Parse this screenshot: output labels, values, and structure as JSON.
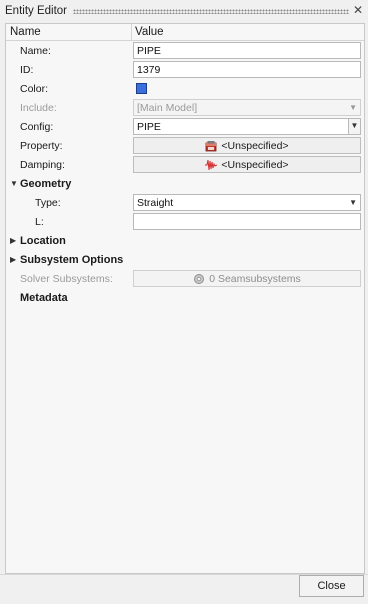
{
  "window": {
    "title": "Entity Editor",
    "close_glyph": "✕"
  },
  "table": {
    "col_name": "Name",
    "col_value": "Value"
  },
  "fields": {
    "name": {
      "label": "Name:",
      "value": "PIPE"
    },
    "id": {
      "label": "ID:",
      "value": "1379"
    },
    "color": {
      "label": "Color:",
      "color": "#3b6fe0"
    },
    "include": {
      "label": "Include:",
      "value": "[Main Model]"
    },
    "config": {
      "label": "Config:",
      "value": "PIPE"
    },
    "property": {
      "label": "Property:",
      "value": "<Unspecified>",
      "icon": "property-icon"
    },
    "damping": {
      "label": "Damping:",
      "value": "<Unspecified>",
      "icon": "damping-icon"
    }
  },
  "sections": {
    "geometry": "Geometry",
    "location": "Location",
    "subsystem_options": "Subsystem Options",
    "metadata": "Metadata"
  },
  "geometry": {
    "type": {
      "label": "Type:",
      "value": "Straight"
    },
    "l": {
      "label": "L:",
      "value": ""
    }
  },
  "subsystem": {
    "label": "Solver Subsystems:",
    "value": "0 Seamsubsystems",
    "icon": "gear-icon"
  },
  "footer": {
    "close_label": "Close"
  }
}
